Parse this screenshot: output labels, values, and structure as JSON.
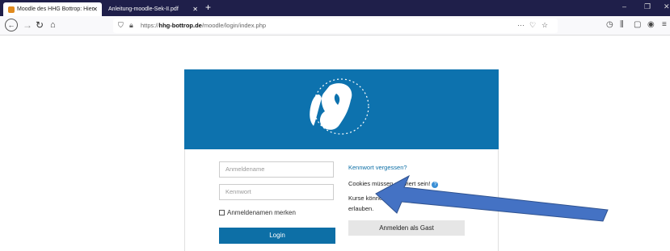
{
  "browser": {
    "tabs": [
      {
        "title": "Moodle des HHG Bottrop: Hier",
        "active": true
      },
      {
        "title": "Anleitung-moodle-Sek-II.pdf",
        "active": false
      }
    ],
    "new_tab": "+",
    "url_prefix": "https://",
    "url_host": "hhg-bottrop.de",
    "url_path": "/moodle/login/index.php",
    "window_controls": [
      "–",
      "❐",
      "✕"
    ]
  },
  "login": {
    "username_placeholder": "Anmeldename",
    "password_placeholder": "Kennwort",
    "remember_label": "Anmeldenamen merken",
    "login_button": "Login",
    "forgot_link": "Kennwort vergessen?",
    "cookies_text": "Cookies müssen aktiviert sein!",
    "guest_text_line1": "Kurse können",
    "guest_text_line2": "erlauben.",
    "guest_button": "Anmelden als Gast"
  },
  "colors": {
    "banner": "#0d72ae",
    "primary_button": "#0d6fa6",
    "arrow": "#4472c4"
  }
}
